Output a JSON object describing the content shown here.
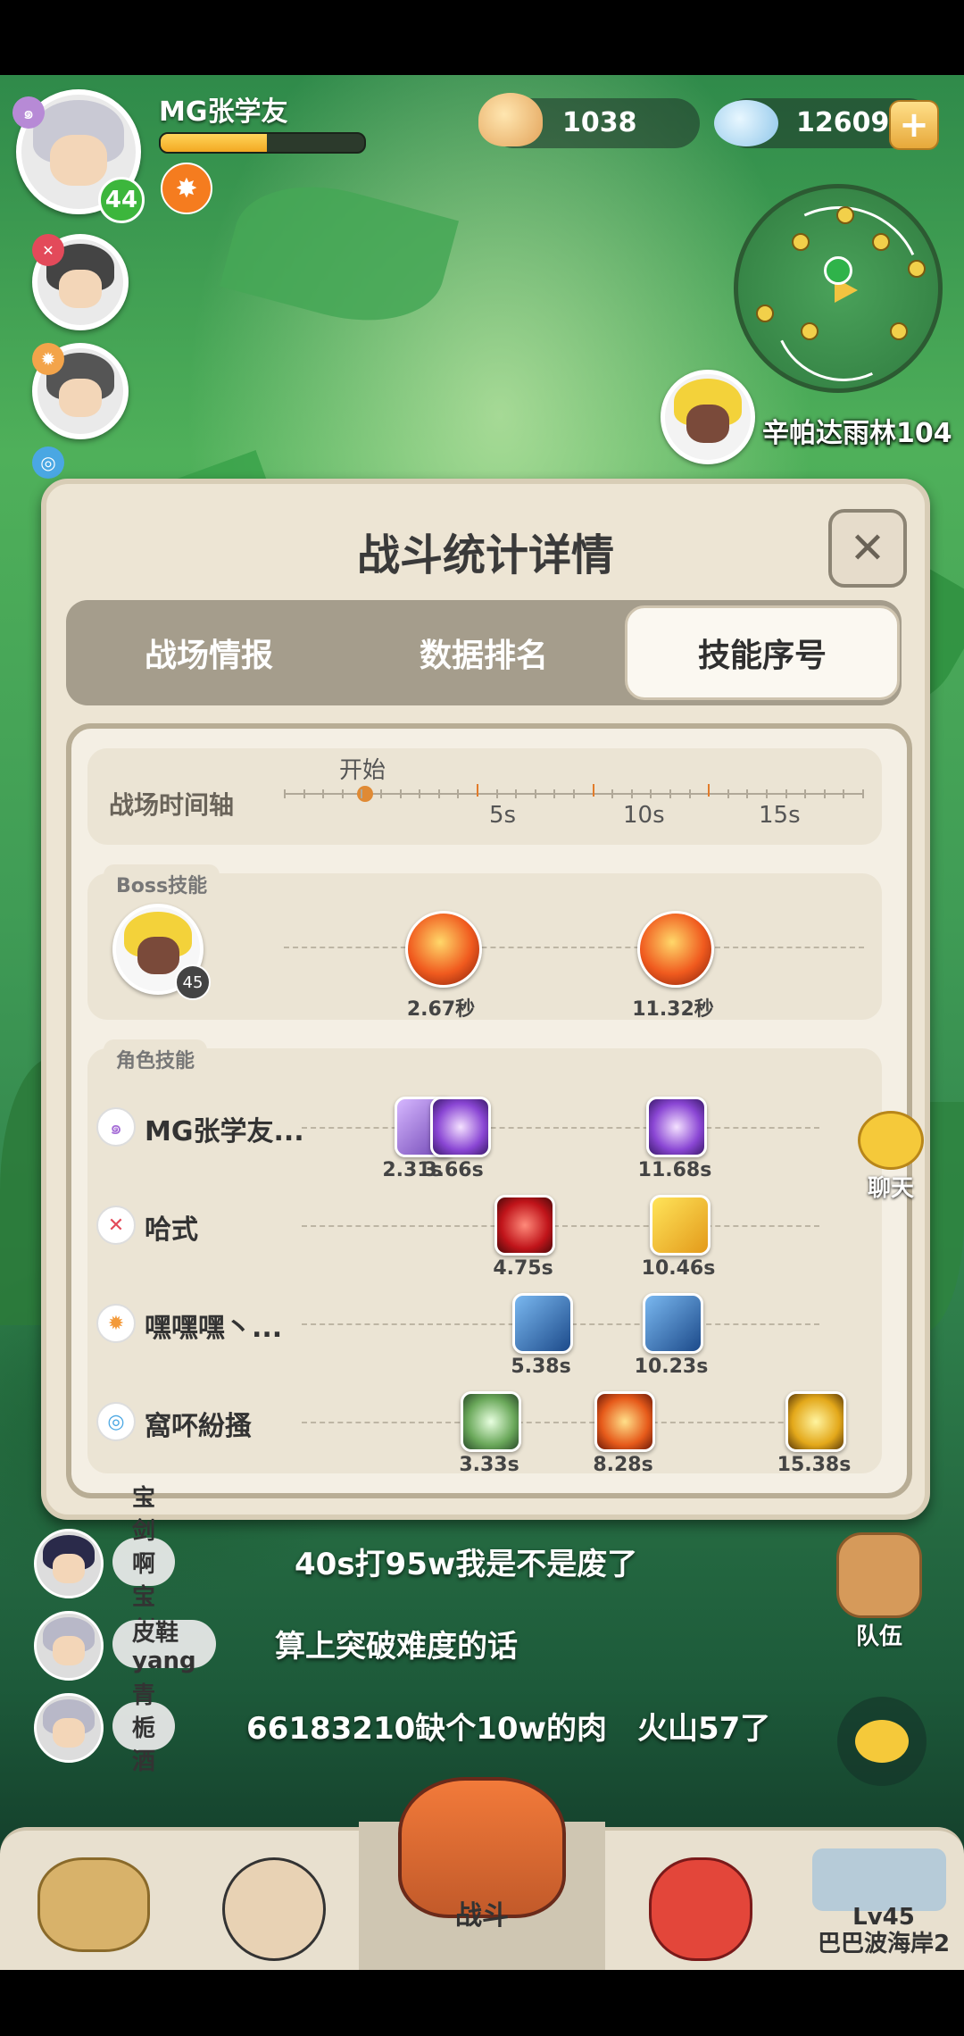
{
  "player": {
    "name": "MG张学友",
    "level": "44",
    "xp_fraction": 0.52
  },
  "currencies": {
    "shells": "1038",
    "diamonds": "12609",
    "add_icon": "plus-icon"
  },
  "area": {
    "name": "辛帕达雨林104"
  },
  "panel": {
    "title": "战斗统计详情",
    "close_icon": "close-icon",
    "tabs": [
      "战场情报",
      "数据排名",
      "技能序号"
    ],
    "active_tab": 2
  },
  "timeline": {
    "label": "战场时间轴",
    "start_label": "开始",
    "ticks": [
      "5s",
      "10s",
      "15s"
    ]
  },
  "boss_section": {
    "tag": "Boss技能",
    "boss_level": "45",
    "skills": [
      {
        "time": "2.67秒"
      },
      {
        "time": "11.32秒"
      }
    ]
  },
  "role_section": {
    "tag": "角色技能",
    "rows": [
      {
        "name": "MG张学友...",
        "times": [
          "2.31s",
          "3.66s",
          "11.68s"
        ]
      },
      {
        "name": "哈式",
        "times": [
          "4.75s",
          "10.46s"
        ]
      },
      {
        "name": "嘿嘿嘿丶...",
        "times": [
          "5.38s",
          "10.23s"
        ]
      },
      {
        "name": "窩吥紛搔",
        "times": [
          "3.33s",
          "8.28s",
          "15.38s"
        ]
      }
    ]
  },
  "chat": {
    "messages": [
      {
        "nick": "宝剑啊宝剑",
        "text": "40s打95w我是不是废了"
      },
      {
        "nick": "皮鞋yang",
        "text": "算上突破难度的话"
      },
      {
        "nick": "青栀酒",
        "text": "66183210缺个10w的肉　火山57了"
      }
    ]
  },
  "side_buttons": {
    "chat": "聊天",
    "team": "队伍"
  },
  "bottom_nav": {
    "battle": "战斗",
    "locked_level": "Lv45",
    "locked_place": "巴巴波海岸2"
  },
  "colors": {
    "panel_bg": "#ede5d4",
    "tab_bar": "#a59d8c",
    "timeline_accent": "#e27b2a",
    "level_badge": "#3cb63c"
  }
}
